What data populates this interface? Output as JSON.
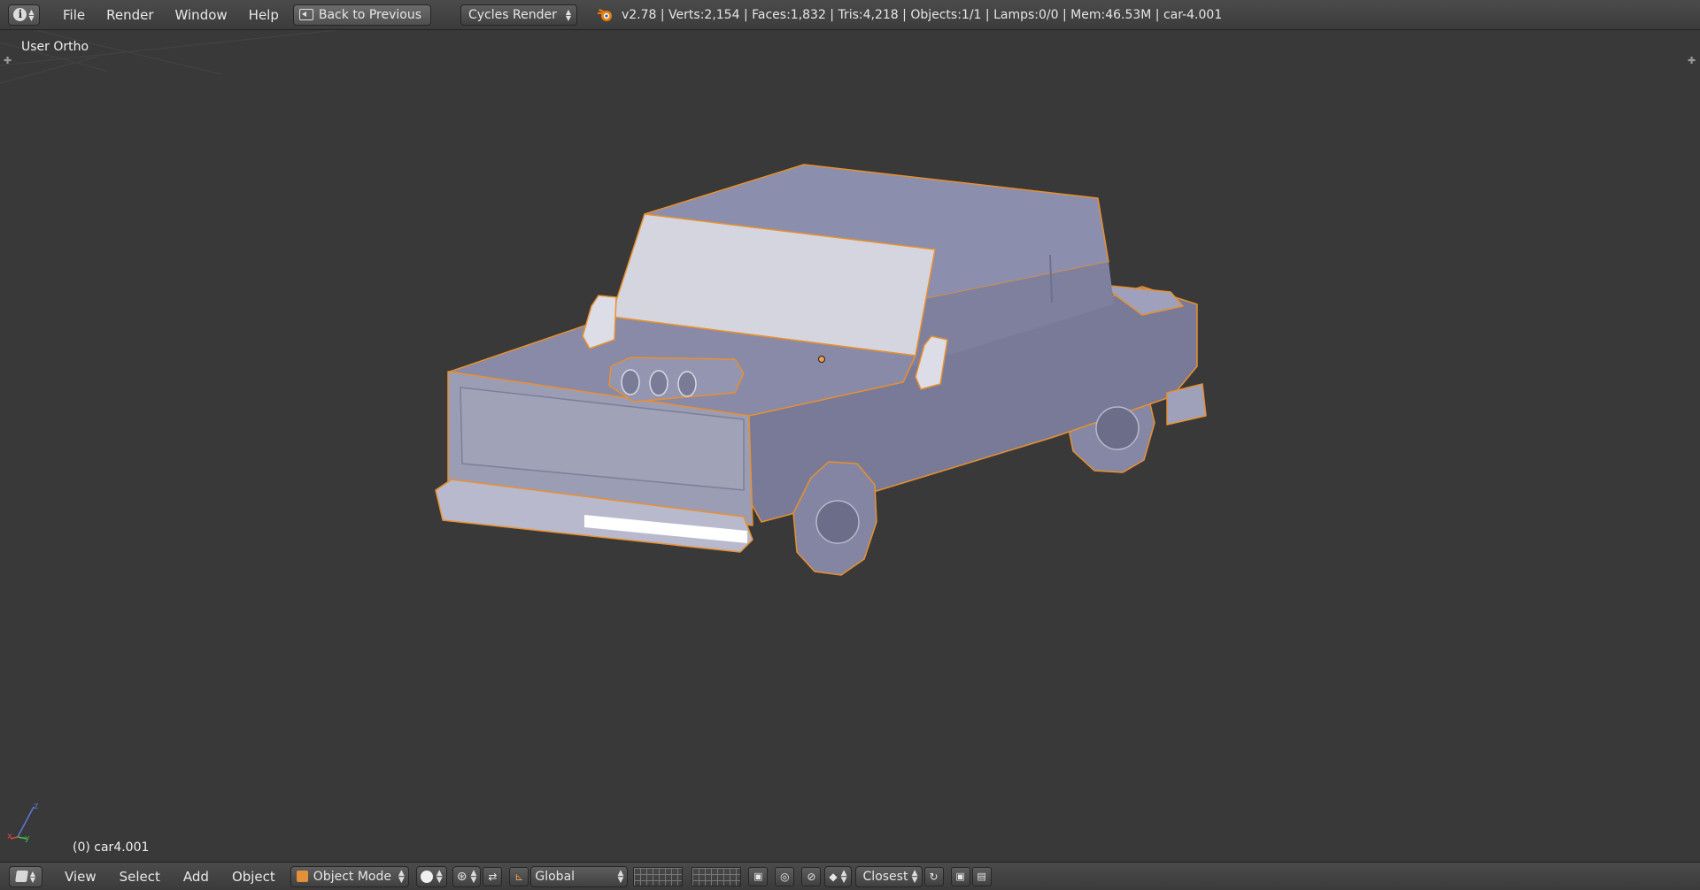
{
  "topbar": {
    "menu": [
      "File",
      "Render",
      "Window",
      "Help"
    ],
    "back_label": "Back to Previous",
    "render_engine": "Cycles Render",
    "stats": "v2.78 | Verts:2,154 | Faces:1,832 | Tris:4,218 | Objects:1/1 | Lamps:0/0 | Mem:46.53M | car-4.001"
  },
  "viewport": {
    "view_label": "User Ortho",
    "object_label": "(0) car4.001",
    "axis_labels": {
      "x": "x",
      "y": "y",
      "z": "z"
    },
    "selection_outline_color": "#e8902e",
    "model_color": "#8e90ad"
  },
  "bottombar": {
    "menu": [
      "View",
      "Select",
      "Add",
      "Object"
    ],
    "mode": "Object Mode",
    "transform_orientation": "Global",
    "snap_target": "Closest"
  }
}
